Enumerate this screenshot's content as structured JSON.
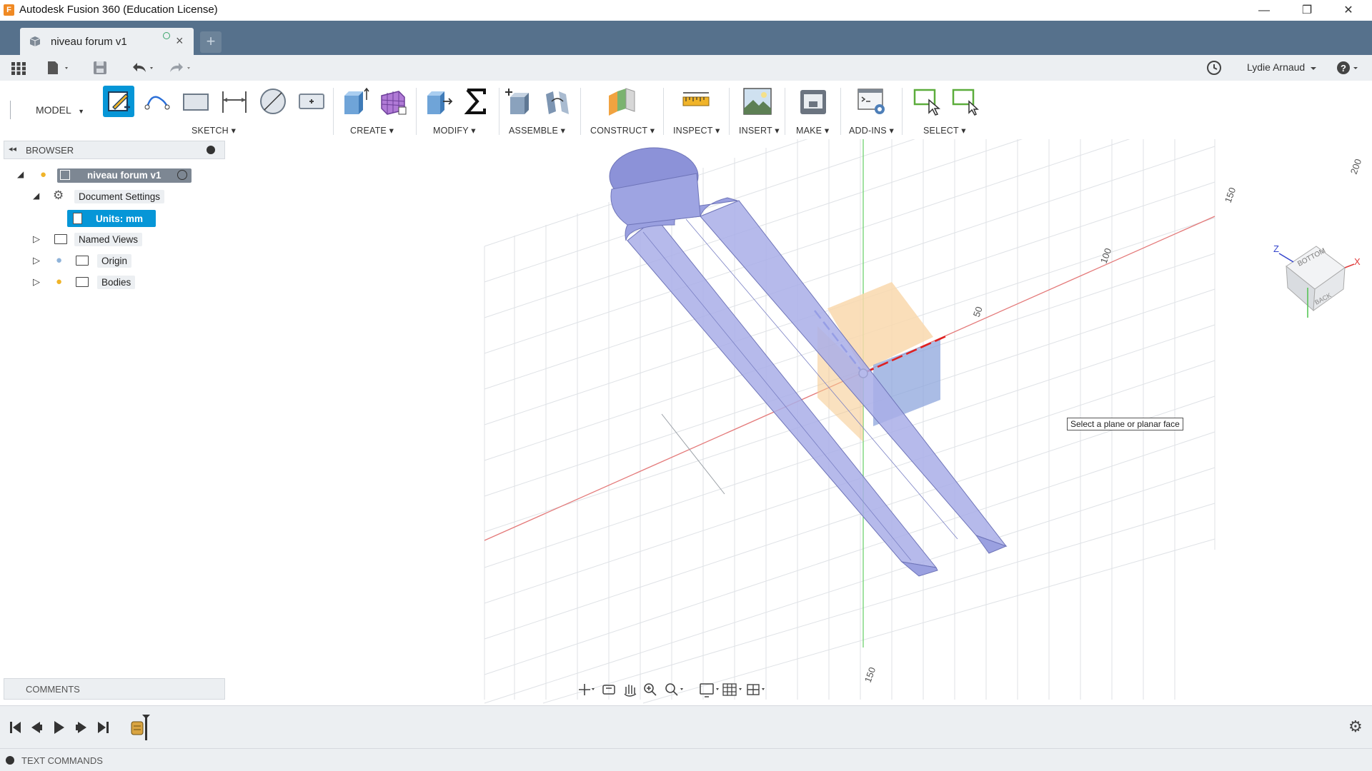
{
  "app": {
    "title": "Autodesk Fusion 360 (Education License)",
    "logo_letter": "F"
  },
  "window_controls": {
    "minimize": "—",
    "restore": "❐",
    "close": "✕"
  },
  "document_tab": {
    "name": "niveau forum v1",
    "new_tab": "+"
  },
  "quick_access": {
    "user_name": "Lydie Arnaud",
    "help": "?"
  },
  "toolbar": {
    "workspace": "MODEL",
    "groups": {
      "sketch": "SKETCH",
      "create": "CREATE",
      "modify": "MODIFY",
      "assemble": "ASSEMBLE",
      "construct": "CONSTRUCT",
      "inspect": "INSPECT",
      "insert": "INSERT",
      "make": "MAKE",
      "addins": "ADD-INS",
      "select": "SELECT"
    }
  },
  "browser": {
    "title": "BROWSER",
    "root": "niveau forum v1",
    "items": [
      {
        "label": "Document Settings"
      },
      {
        "label": "Units: mm"
      },
      {
        "label": "Named Views"
      },
      {
        "label": "Origin"
      },
      {
        "label": "Bodies"
      }
    ]
  },
  "viewport": {
    "tooltip": "Select a plane or planar face",
    "axis_labels": [
      "50",
      "100",
      "150",
      "150",
      "200"
    ],
    "view_cube": {
      "faces": [
        "BOTTOM",
        "BACK"
      ],
      "axes": [
        "Z",
        "X"
      ]
    }
  },
  "panels": {
    "comments": "COMMENTS",
    "text_commands": "TEXT COMMANDS"
  },
  "colors": {
    "tab_strip": "#56718c",
    "panel_bg": "#eceff2",
    "accent_blue": "#0696d7",
    "body_fill": "#a9aee8",
    "x_axis": "#e03b3b",
    "y_axis": "#3bbf3b",
    "plane_orange": "#f6c88a",
    "plane_blue": "#8ea6dc"
  }
}
